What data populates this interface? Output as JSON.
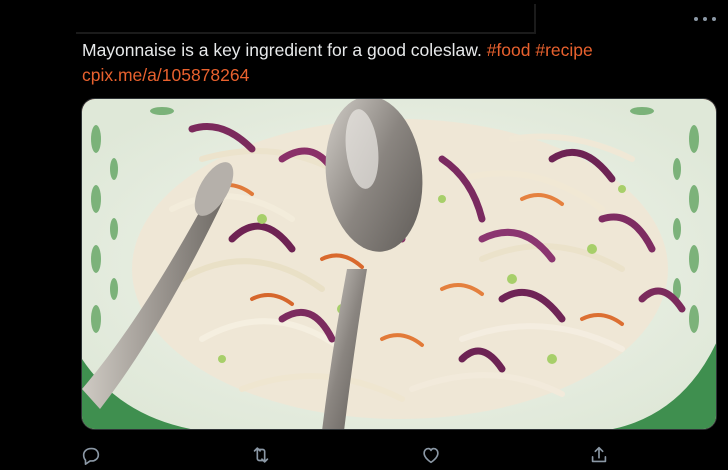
{
  "tweet": {
    "text": "Mayonnaise is a key ingredient for a good coleslaw.",
    "hashtags": [
      "#food",
      "#recipe"
    ],
    "link": "cpix.me/a/105878264"
  },
  "media": {
    "subject": "bowl of coleslaw with two serving spoons"
  },
  "actions": {
    "icons": [
      "reply-icon",
      "retweet-icon",
      "like-icon",
      "share-icon"
    ]
  },
  "colors": {
    "background": "#000000",
    "text": "#e7e9ea",
    "link": "#e8612e",
    "icon": "#8b98a5"
  }
}
